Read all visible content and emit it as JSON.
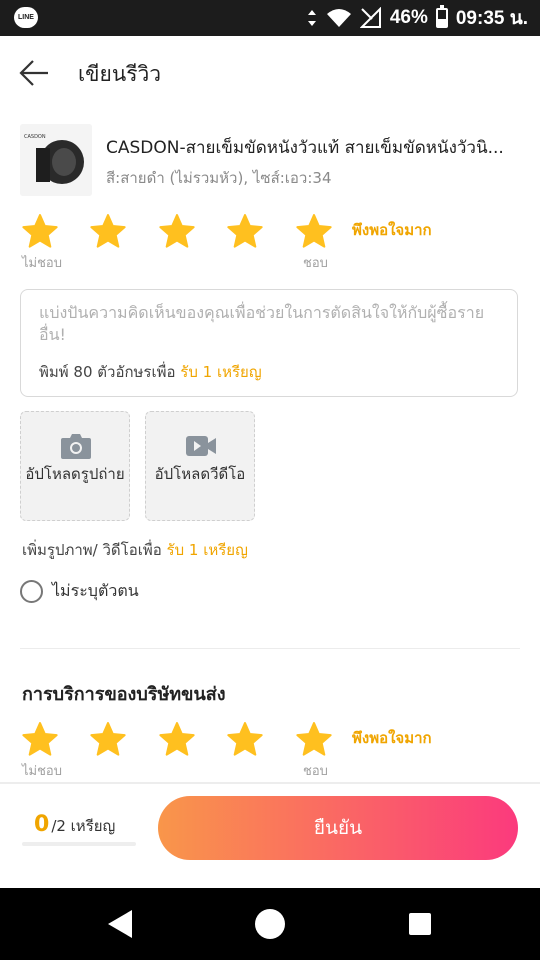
{
  "status_bar": {
    "app_badge": "LINE",
    "battery": "46%",
    "battery_level": 0.46,
    "time": "09:35 น."
  },
  "header": {
    "title": "เขียนรีวิว"
  },
  "product": {
    "name": "CASDON-สายเข็มขัดหนังวัวแท้ สายเข็มขัดหนังวัวนิ...",
    "variation": "สี:สายดำ (ไม่รวมหัว), ไซส์:เอว:34",
    "thumb_logo": "CASDON"
  },
  "product_rating": {
    "stars": 5,
    "label": "พึงพอใจมาก",
    "hint_low": "ไม่ชอบ",
    "hint_high": "ชอบ"
  },
  "review": {
    "placeholder": "แบ่งปันความคิดเห็นของคุณเพื่อช่วยในการตัดสินใจให้กับผู้ซื้อรายอื่น!",
    "min_chars_prefix": "พิมพ์ 80  ตัวอักษรเพื่อ",
    "min_chars_reward": "รับ 1 เหรียญ"
  },
  "uploads": {
    "photo_label": "อัปโหลดรูปถ่าย",
    "video_label": "อัปโหลดวีดีโอ",
    "reward_prefix": "เพิ่มรูปภาพ/ วิดีโอเพื่อ",
    "reward_text": "รับ 1 เหรียญ"
  },
  "anonymous": {
    "label": "ไม่ระบุตัวตน",
    "checked": false
  },
  "shipping": {
    "title": "การบริการของบริษัทขนส่ง",
    "stars": 5,
    "label": "พึงพอใจมาก",
    "hint_low": "ไม่ชอบ",
    "hint_high": "ชอบ"
  },
  "footer": {
    "coins_earned": "0",
    "coins_total": "/2 เหรียญ",
    "confirm_label": "ยืนยัน"
  },
  "colors": {
    "accent": "#f0a500",
    "star": "#ffc01f",
    "button_gradient_start": "#f9964a",
    "button_gradient_end": "#fb3a7d"
  }
}
